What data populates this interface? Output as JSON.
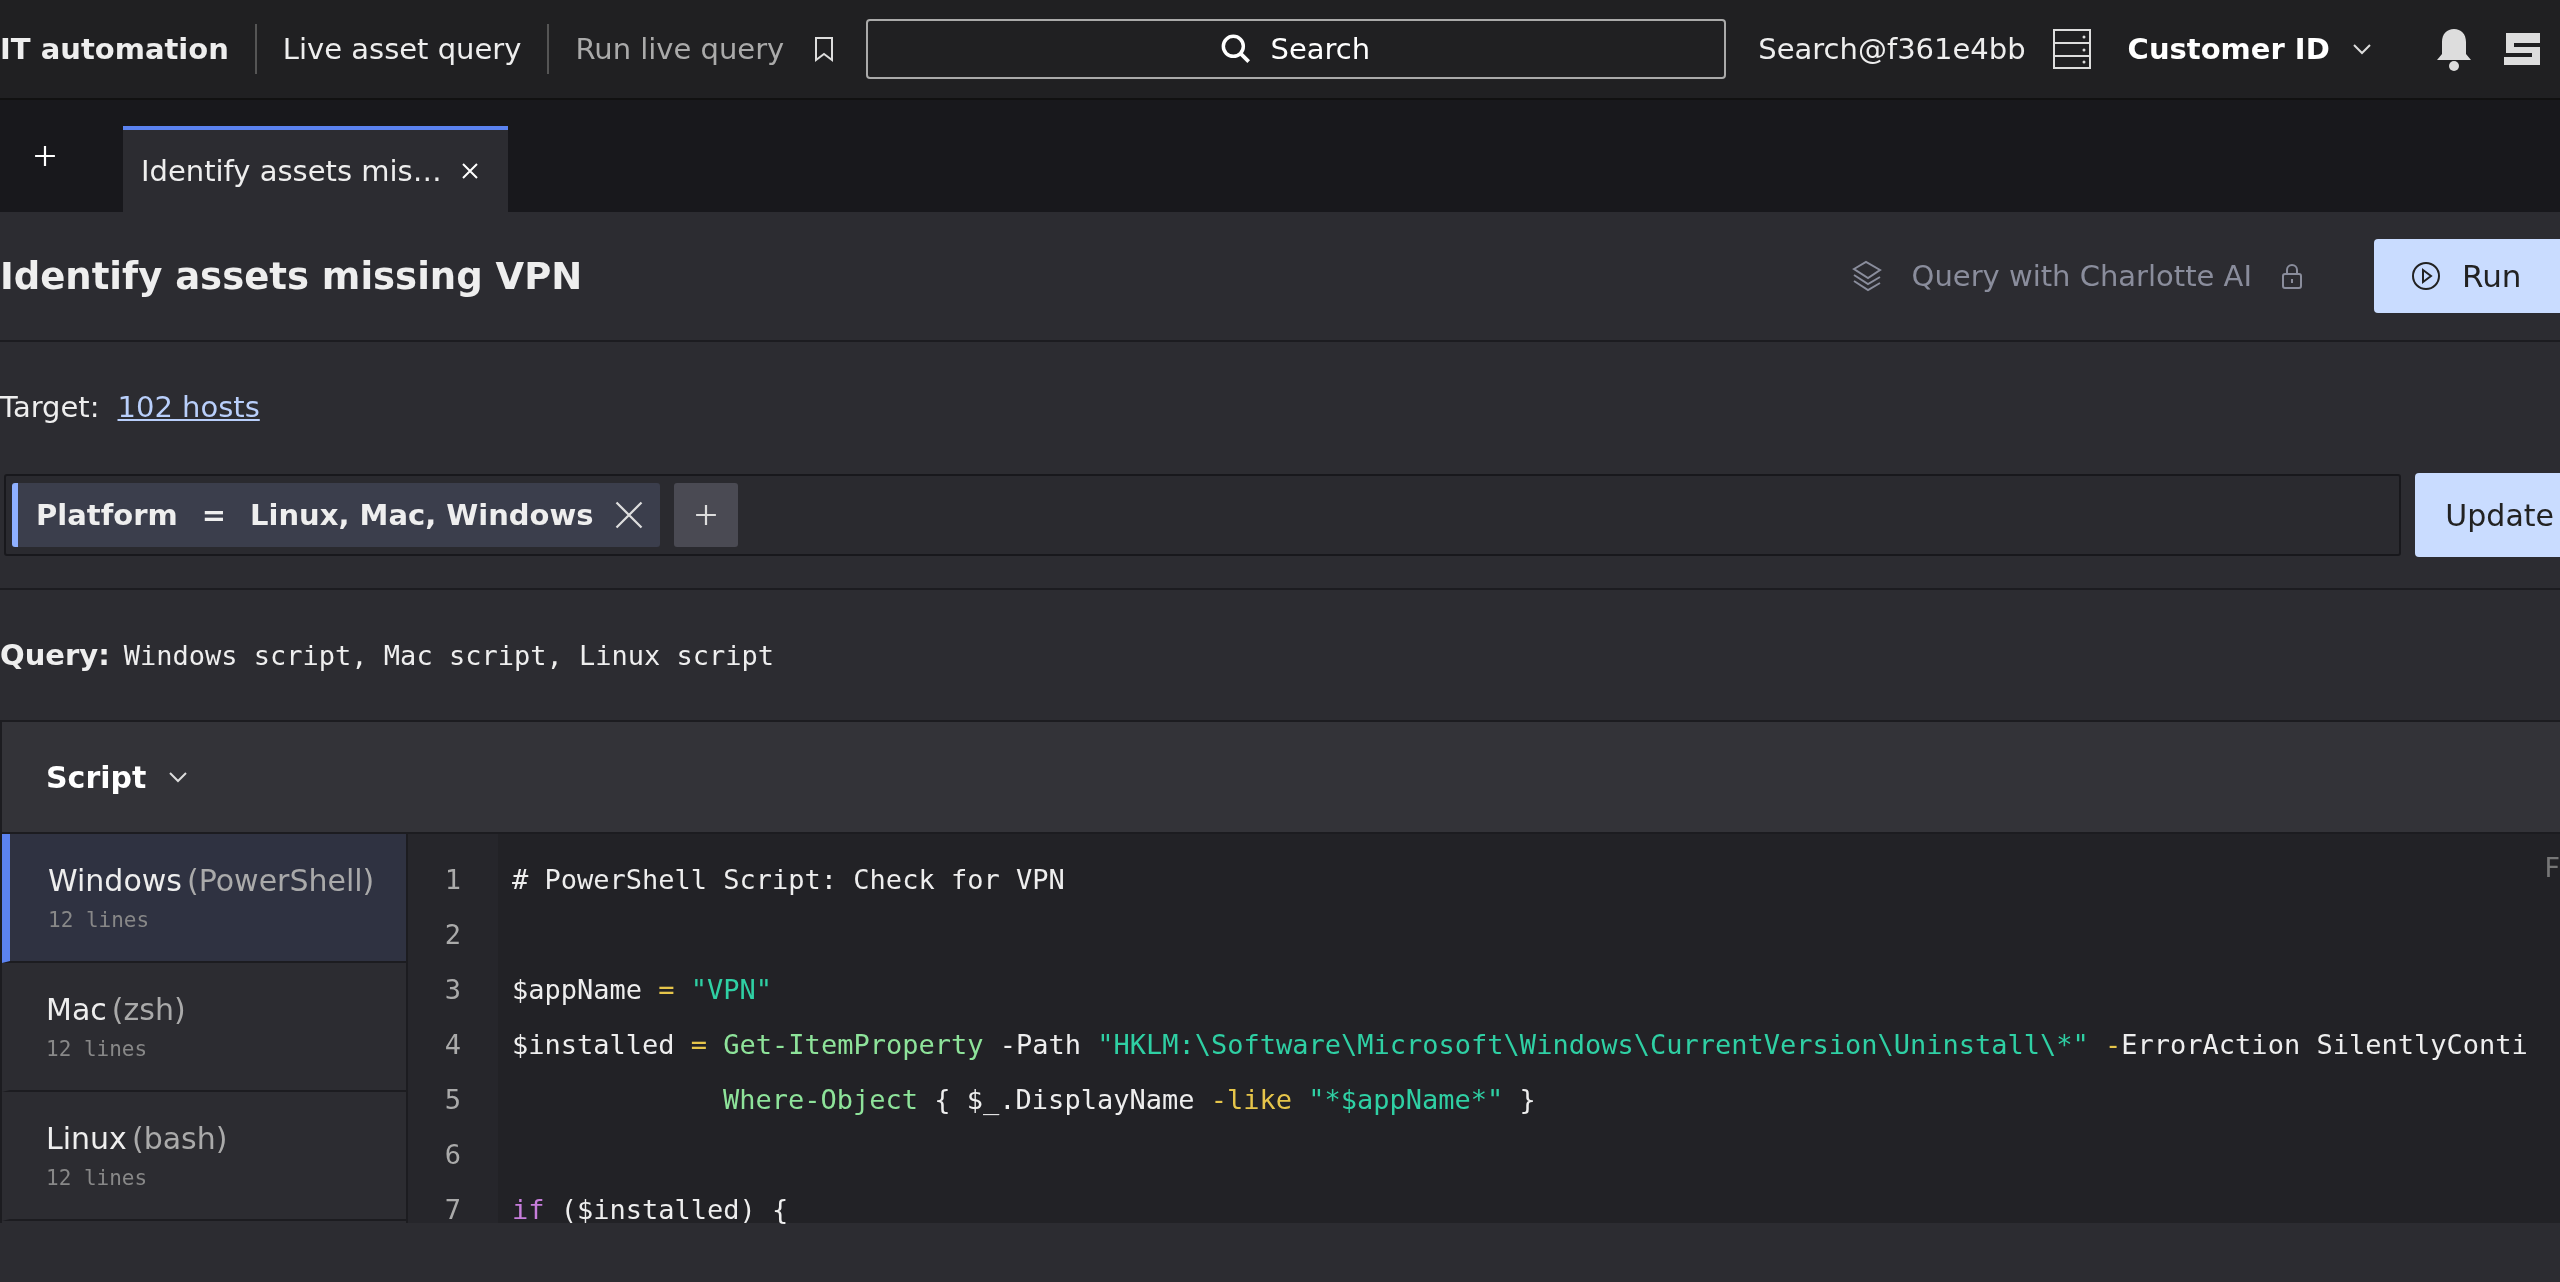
{
  "top_bar": {
    "breadcrumbs": [
      {
        "label": "IT automation",
        "kind": "section"
      },
      {
        "label": "Live asset query",
        "kind": "page"
      },
      {
        "label": "Run live query",
        "kind": "current"
      }
    ],
    "search": {
      "placeholder": "Search"
    },
    "account": "Search@f361e4bb",
    "customer": "Customer ID"
  },
  "tabs": [
    {
      "label": "Identify assets mis…",
      "selected": true
    }
  ],
  "title": "Identify assets missing VPN",
  "ai_query": {
    "label": "Query with Charlotte AI",
    "locked": true
  },
  "run_button": "Run",
  "target": {
    "label": "Target:",
    "link": "102 hosts"
  },
  "filter": {
    "field": "Platform",
    "operator": "=",
    "value": "Linux, Mac, Windows"
  },
  "update_button": "Update",
  "query": {
    "label": "Query:",
    "value": "Windows script, Mac script, Linux script"
  },
  "script_panel": {
    "title": "Script",
    "scripts": [
      {
        "name": "Windows",
        "shell": "(PowerShell)",
        "lines": "12 lines",
        "selected": true
      },
      {
        "name": "Mac",
        "shell": "(zsh)",
        "lines": "12 lines",
        "selected": false
      },
      {
        "name": "Linux",
        "shell": "(bash)",
        "lines": "12 lines",
        "selected": false
      }
    ],
    "corner_text": "F",
    "code": [
      {
        "number": "1",
        "tokens": [
          {
            "kind": "plain",
            "text": "# PowerShell Script: Check for VPN"
          }
        ]
      },
      {
        "number": "2"
      },
      {
        "number": "3",
        "tokens": [
          {
            "kind": "plain",
            "text": "$appName"
          },
          {
            "kind": "operator",
            "text": " = "
          },
          {
            "kind": "string",
            "text": "\"VPN\""
          }
        ]
      },
      {
        "number": "4",
        "tokens": [
          {
            "kind": "plain",
            "text": "$installed"
          },
          {
            "kind": "operator",
            "text": " = "
          },
          {
            "kind": "command",
            "text": "Get-ItemProperty"
          },
          {
            "kind": "plain",
            "text": " -Path "
          },
          {
            "kind": "string",
            "text": "\"HKLM:\\Software\\Microsoft\\Windows\\CurrentVersion\\Uninstall\\*\""
          },
          {
            "kind": "operator",
            "text": " -"
          },
          {
            "kind": "plain",
            "text": "ErrorAction SilentlyConti"
          }
        ]
      },
      {
        "number": "5",
        "indented": true,
        "tokens": [
          {
            "kind": "command",
            "text": "Where-Object"
          },
          {
            "kind": "plain",
            "text": " { $_.DisplayName "
          },
          {
            "kind": "parameter",
            "text": "-like"
          },
          {
            "kind": "string",
            "text": " \"*$appName*\""
          },
          {
            "kind": "plain",
            "text": " }"
          }
        ]
      },
      {
        "number": "6"
      },
      {
        "number": "7",
        "tokens": [
          {
            "kind": "keyword",
            "text": "if"
          },
          {
            "kind": "plain",
            "text": " ($installed) {"
          }
        ]
      }
    ]
  }
}
